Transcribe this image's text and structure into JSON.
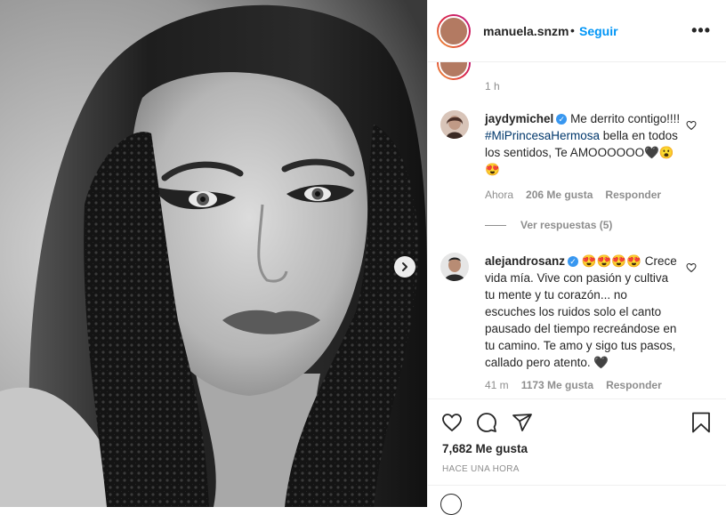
{
  "post": {
    "username": "manuela.snzm",
    "follow_label": "Seguir",
    "separator": "•",
    "more_label": "•••"
  },
  "caption": {
    "time": "1 h"
  },
  "comments": [
    {
      "username": "jaydymichel",
      "text_before": "Me derrito contigo!!!! ",
      "hashtag": "#MiPrincesaHermosa",
      "text_after": " bella en todos los sentidos, Te AMOOOOOO🖤😮😍",
      "time": "Ahora",
      "likes": "206 Me gusta",
      "reply_label": "Responder",
      "view_replies": "Ver respuestas (5)"
    },
    {
      "username": "alejandrosanz",
      "text_before": "😍😍😍😍 Crece vida mía. Vive con pasión y cultiva tu mente y tu corazón... no escuches los ruidos solo el canto pausado del tiempo recreándose en tu camino. Te amo y sigo tus pasos, callado pero atento. 🖤",
      "time": "41 m",
      "likes": "1173 Me gusta",
      "reply_label": "Responder"
    }
  ],
  "footer": {
    "likes": "7,682 Me gusta",
    "time": "HACE UNA HORA"
  },
  "icons": {
    "like": "heart-icon",
    "comment": "comment-icon",
    "share": "share-icon",
    "save": "bookmark-icon",
    "next": "chevron-right-icon",
    "verified": "verified-badge-icon"
  },
  "colors": {
    "link_blue": "#0095f6",
    "verified_blue": "#3897f0",
    "hashtag": "#00376b",
    "muted": "#8e8e8e"
  }
}
